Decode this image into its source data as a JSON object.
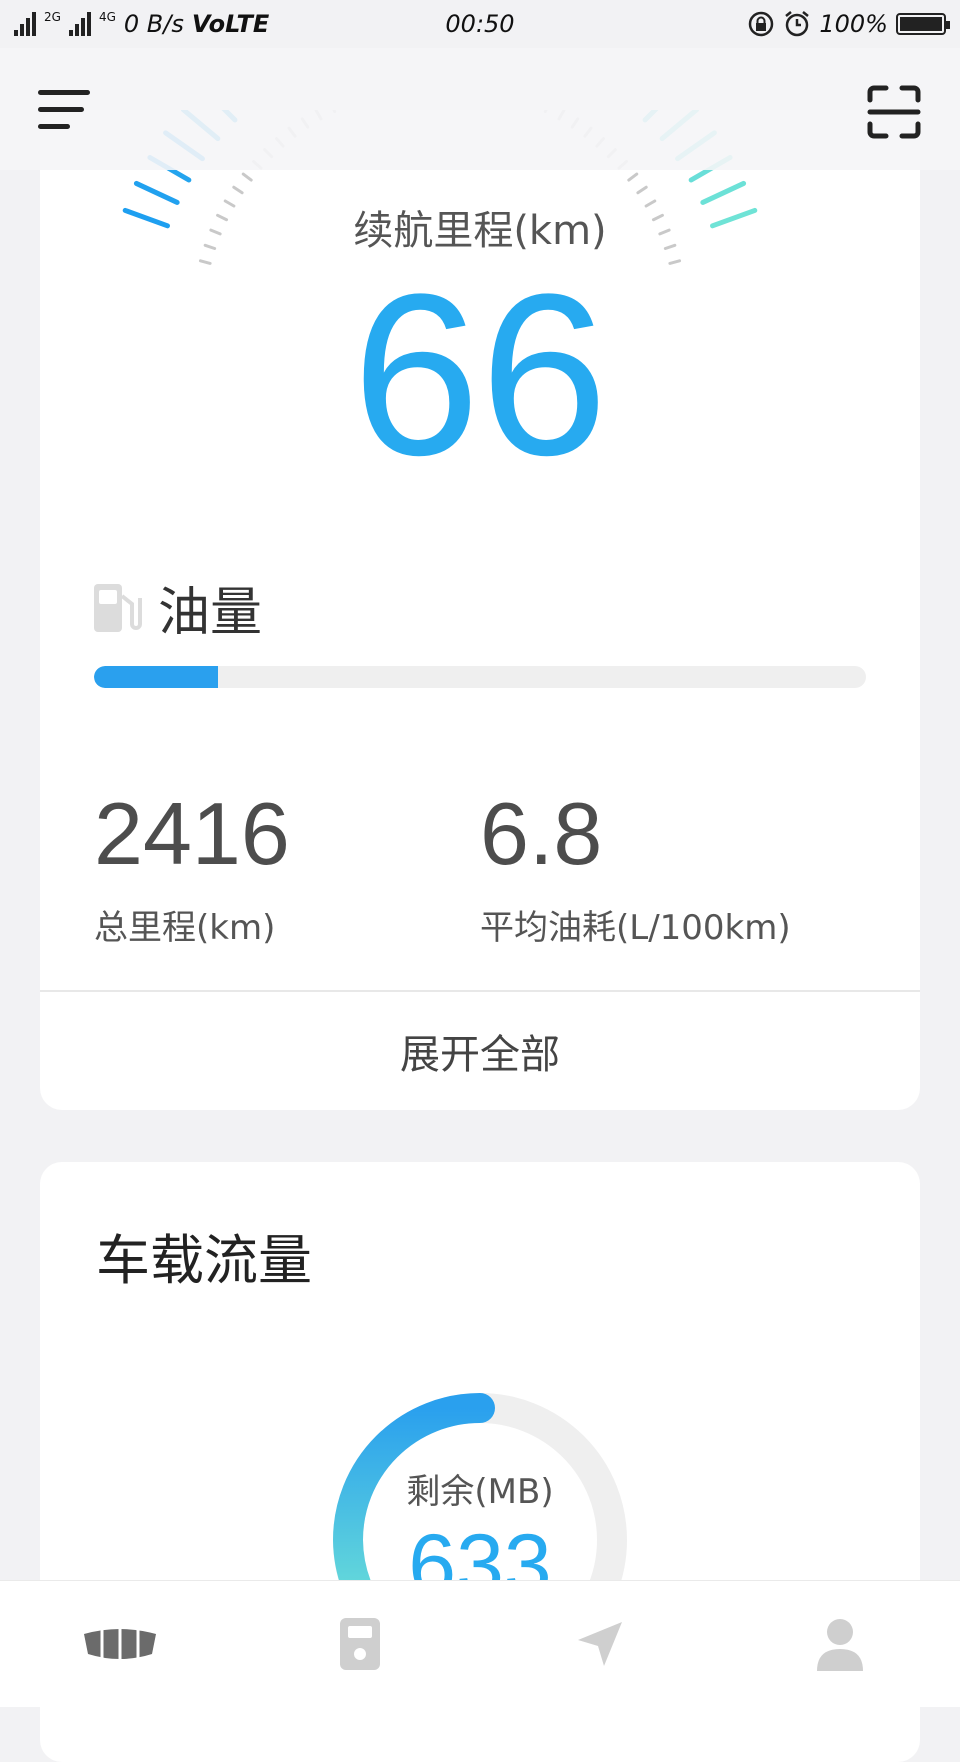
{
  "status_bar": {
    "network_small": "2G",
    "network_small2": "4G",
    "speed": "0 B/s",
    "volte": "VoLTE",
    "time": "00:50",
    "battery": "100%"
  },
  "vehicle": {
    "range_label": "续航里程(km)",
    "range_value": "66",
    "fuel_label": "油量",
    "fuel_level_percent": 16,
    "total_mileage_value": "2416",
    "total_mileage_label": "总里程(km)",
    "avg_consumption_value": "6.8",
    "avg_consumption_label": "平均油耗(L/100km)",
    "expand_label": "展开全部"
  },
  "data_card": {
    "title": "车载流量",
    "remaining_label": "剩余(MB)",
    "remaining_value": "633"
  },
  "colors": {
    "accent": "#27aaf0",
    "gauge_teal": "#6fe3d6",
    "text_dark": "#333333"
  },
  "bottom_nav": [
    "car-brand-icon",
    "key-icon",
    "navigation-icon",
    "user-icon"
  ]
}
